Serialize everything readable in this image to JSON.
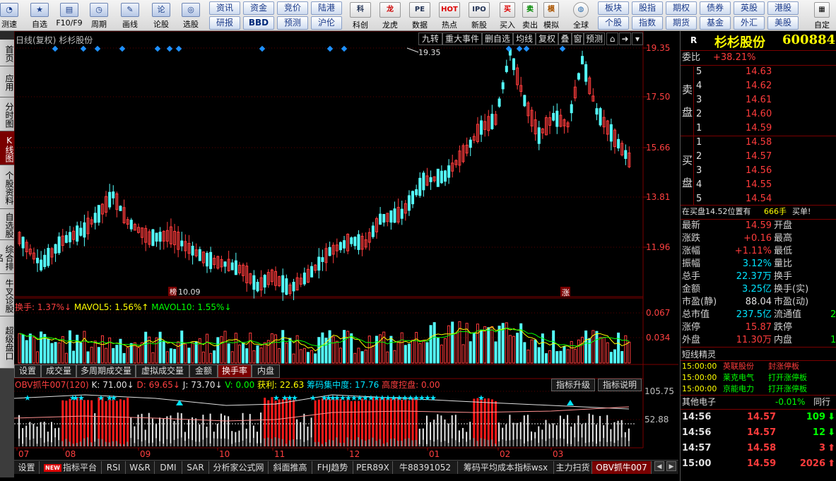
{
  "toolbar": {
    "buttons": [
      {
        "label": "测速",
        "icon": "speedometer-icon"
      },
      {
        "label": "自选",
        "icon": "star-icon"
      },
      {
        "label": "F10/F9",
        "icon": "info-icon"
      },
      {
        "label": "周期",
        "icon": "clock-icon"
      },
      {
        "label": "画线",
        "icon": "pen-icon"
      },
      {
        "label": "论股",
        "icon": "chat-icon"
      },
      {
        "label": "选股",
        "icon": "chart-icon"
      }
    ],
    "pills_row1": [
      "资讯",
      "资金",
      "竞价",
      "陆港"
    ],
    "pills_row2": [
      "研报",
      "BBD",
      "预测",
      "沪伦"
    ],
    "icons2": [
      {
        "label": "科创",
        "glyph": "科"
      },
      {
        "label": "龙虎",
        "glyph": "龙"
      },
      {
        "label": "数据",
        "glyph": "PE"
      },
      {
        "label": "热点",
        "glyph": "HOT"
      },
      {
        "label": "新股",
        "glyph": "IPO"
      }
    ],
    "trade": [
      {
        "label": "买入",
        "glyph": "买"
      },
      {
        "label": "卖出",
        "glyph": "卖"
      },
      {
        "label": "模拟",
        "glyph": "模"
      }
    ],
    "global_label": "全球",
    "pills2_row1": [
      "板块",
      "股指",
      "期权",
      "债券",
      "英股",
      "港股"
    ],
    "pills2_row2": [
      "个股",
      "指数",
      "期货",
      "基金",
      "外汇",
      "美股"
    ],
    "custom_label": "自定"
  },
  "leftnav": [
    "首页",
    "应用",
    "分时图",
    "K线图",
    "个股资料",
    "自选股",
    "综合排名",
    "牛叉诊股",
    "超级盘口"
  ],
  "chart": {
    "title": "日线(复权)",
    "stock_name": "杉杉股份",
    "top_buttons": [
      "九转",
      "重大事件",
      "删自选",
      "均线",
      "复权",
      "叠",
      "窗",
      "预测"
    ],
    "price_ticks": [
      "19.35",
      "17.50",
      "15.66",
      "13.81",
      "11.96"
    ],
    "high_label": "19.35",
    "low_label": "10.09",
    "zhang_label": "涨",
    "vol_ticks": [
      "0.067",
      "0.034"
    ],
    "turnover": {
      "label": "换手:",
      "value": "1.37%",
      "ma5_label": "MAVOL5:",
      "ma5_value": "1.56%",
      "ma10_label": "MAVOL10:",
      "ma10_value": "1.55%"
    },
    "sub_tabs": [
      "设置",
      "成交量",
      "多周期成交量",
      "虚拟成交量",
      "金额",
      "换手率",
      "内盘"
    ],
    "obv": {
      "name": "OBV抓牛007(120)",
      "k": "K: 71.00",
      "d": "D: 69.65",
      "j": "J: 73.70",
      "v": "V: 0.00",
      "profit": "获利: 22.63",
      "conc": "筹码集中度: 17.76",
      "ctrl": "高度控盘: 0.00"
    },
    "obv_buttons": [
      "指标升级",
      "指标说明"
    ],
    "obv_ticks": [
      "105.75",
      "52.88"
    ],
    "months": [
      "07",
      "08",
      "09",
      "10",
      "11",
      "12",
      "01",
      "02",
      "03"
    ]
  },
  "bottom_tabs": [
    "设置",
    "指标平台",
    "RSI",
    "W&R",
    "DMI",
    "SAR",
    "分析家公式网",
    "斜面推高",
    "FHJ趋势",
    "PER89X",
    "牛88391052",
    "筹码平均成本指标wsx",
    "主力扫货",
    "OBV抓牛007"
  ],
  "new_badge": "NEW",
  "quote": {
    "r": "R",
    "name": "杉杉股份",
    "code": "600884",
    "wb_label": "委比",
    "wb_value": "+38.21%",
    "sell_label": [
      "卖",
      "盘"
    ],
    "buy_label": [
      "买",
      "盘"
    ],
    "asks": [
      {
        "lvl": "5",
        "price": "14.63"
      },
      {
        "lvl": "4",
        "price": "14.62"
      },
      {
        "lvl": "3",
        "price": "14.61"
      },
      {
        "lvl": "2",
        "price": "14.60"
      },
      {
        "lvl": "1",
        "price": "14.59"
      }
    ],
    "bids": [
      {
        "lvl": "1",
        "price": "14.58"
      },
      {
        "lvl": "2",
        "price": "14.57"
      },
      {
        "lvl": "3",
        "price": "14.56"
      },
      {
        "lvl": "4",
        "price": "14.55"
      },
      {
        "lvl": "5",
        "price": "14.54"
      }
    ],
    "alert": {
      "text": "在买盘14.52位置有",
      "vol": "666手",
      "action": "买单!"
    },
    "stats": [
      {
        "l1": "最新",
        "v1": "14.59",
        "c1": "red",
        "l2": "开盘",
        "v2": ""
      },
      {
        "l1": "涨跌",
        "v1": "+0.16",
        "c1": "red",
        "l2": "最高",
        "v2": ""
      },
      {
        "l1": "涨幅",
        "v1": "+1.11%",
        "c1": "red",
        "l2": "最低",
        "v2": ""
      },
      {
        "l1": "振幅",
        "v1": "3.12%",
        "c1": "cyan",
        "l2": "量比",
        "v2": ""
      },
      {
        "l1": "总手",
        "v1": "22.37万",
        "c1": "cyan",
        "l2": "换手",
        "v2": ""
      },
      {
        "l1": "金额",
        "v1": "3.25亿",
        "c1": "cyan",
        "l2": "换手(实)",
        "v2": ""
      },
      {
        "l1": "市盈(静)",
        "v1": "88.04",
        "c1": "white",
        "l2": "市盈(动)",
        "v2": ""
      },
      {
        "l1": "总市值",
        "v1": "237.5亿",
        "c1": "cyan",
        "l2": "流通值",
        "v2": "2"
      },
      {
        "l1": "涨停",
        "v1": "15.87",
        "c1": "red",
        "l2": "跌停",
        "v2": ""
      },
      {
        "l1": "外盘",
        "v1": "11.30万",
        "c1": "red",
        "l2": "内盘",
        "v2": "1"
      }
    ],
    "elite_title": "短线精灵",
    "elite": [
      {
        "time": "15:00:00",
        "name": "英联股份",
        "event": "封涨停板",
        "color": "red"
      },
      {
        "time": "15:00:00",
        "name": "莱克电气",
        "event": "打开涨停板",
        "color": "green"
      },
      {
        "time": "15:00:00",
        "name": "京能电力",
        "event": "打开涨停板",
        "color": "green"
      }
    ],
    "sector": {
      "name": "其他电子",
      "change": "-0.01%",
      "tail": "同行"
    },
    "ticks": [
      {
        "time": "14:56",
        "price": "14.57",
        "vol": "109",
        "dir": "down"
      },
      {
        "time": "14:56",
        "price": "14.57",
        "vol": "12",
        "dir": "down"
      },
      {
        "time": "14:57",
        "price": "14.58",
        "vol": "3",
        "dir": "up"
      },
      {
        "time": "15:00",
        "price": "14.59",
        "vol": "2026",
        "dir": "up"
      }
    ]
  }
}
